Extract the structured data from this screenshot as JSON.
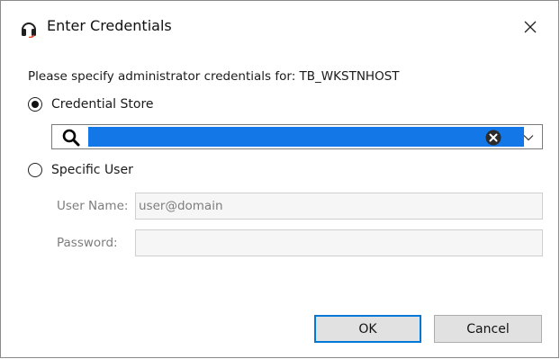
{
  "dialog": {
    "title": "Enter Credentials",
    "app_icon": "headset-icon",
    "close_icon": "close-icon"
  },
  "prompt": "Please specify administrator credentials for: TB_WKSTNHOST",
  "options": {
    "credential_store": {
      "label": "Credential Store",
      "selected": true,
      "value": "",
      "search_icon": "search-icon",
      "clear_icon": "clear-circle-icon",
      "dropdown_icon": "chevron-down-icon"
    },
    "specific_user": {
      "label": "Specific User",
      "selected": false
    }
  },
  "fields": {
    "username_label": "User Name:",
    "username_value": "user@domain",
    "password_label": "Password:",
    "password_value": ""
  },
  "buttons": {
    "ok": "OK",
    "cancel": "Cancel"
  },
  "colors": {
    "selection": "#1477e8",
    "ok_border": "#0078d7",
    "disabled_text": "#7d7d7d"
  }
}
